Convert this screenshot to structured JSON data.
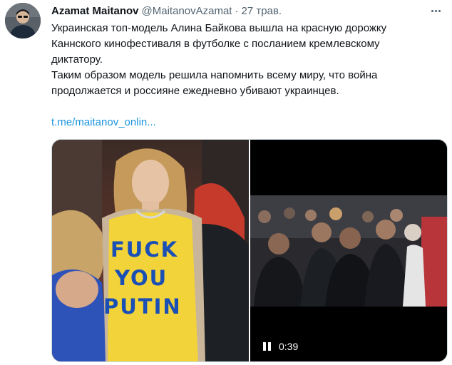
{
  "tweet": {
    "display_name": "Azamat Maitanov",
    "handle": "@MaitanovAzamat",
    "separator": "·",
    "date": "27 трав.",
    "text_lines": [
      "Украинская топ-модель Алина Байкова вышла на красную дорожку",
      "Каннского кинофестиваля в футболке с посланием кремлевскому",
      "диктатору.",
      "Таким образом модель решила напомнить всему миру, что война",
      "продолжается и россияне ежедневно убивают украинцев."
    ],
    "link": "t.me/maitanov_onlin..."
  },
  "media": {
    "shirt_lines": [
      "FUCK",
      "YOU",
      "PUTIN"
    ],
    "video_time": "0:39",
    "icons": {
      "more": "more-horizontal-icon",
      "pause": "pause-icon"
    }
  },
  "colors": {
    "link": "#1b95e0",
    "secondary_text": "#536471",
    "shirt_yellow": "#f2d33a",
    "shirt_letters": "#1a4fb5"
  }
}
